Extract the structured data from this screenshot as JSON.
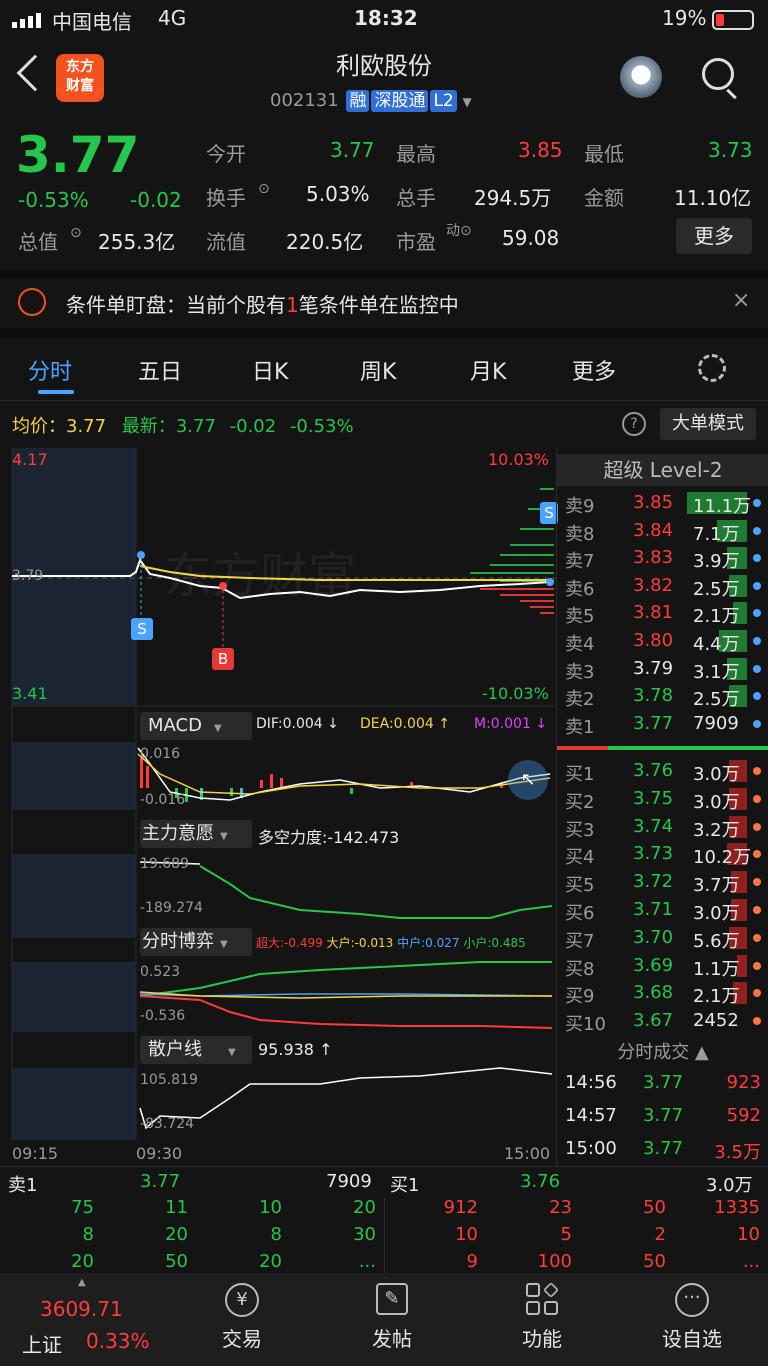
{
  "status": {
    "carrier": "中国电信",
    "net": "4G",
    "time": "18:32",
    "battery": "19%"
  },
  "header": {
    "logo": "东方\n财富",
    "title": "利欧股份",
    "code": "002131",
    "tags": [
      "融",
      "深股通",
      "L2"
    ]
  },
  "quote": {
    "price": "3.77",
    "pct": "-0.53%",
    "chg": "-0.02",
    "f": [
      [
        "今开",
        "3.77"
      ],
      [
        "最高",
        "3.85"
      ],
      [
        "最低",
        "3.73"
      ],
      [
        "换手",
        "5.03%"
      ],
      [
        "总手",
        "294.5万"
      ],
      [
        "金额",
        "11.10亿"
      ],
      [
        "总值",
        "255.3亿"
      ],
      [
        "流值",
        "220.5亿"
      ],
      [
        "市盈",
        "59.08"
      ]
    ],
    "more": "更多"
  },
  "notice": {
    "a": "条件单盯盘：当前个股有",
    "num": "1",
    "b": "笔条件单在监控中"
  },
  "tabs": [
    "分时",
    "五日",
    "日K",
    "周K",
    "月K",
    "更多"
  ],
  "avg": {
    "label": "均价：",
    "avg": "3.77",
    "latest_label": "最新：",
    "latest": "3.77",
    "chg": "-0.02",
    "pct": "-0.53%",
    "mode": "大单模式"
  },
  "chart": {
    "ytop": "4.17",
    "ybot": "3.41",
    "mid": "3.79",
    "ptop": "10.03%",
    "pbot": "-10.03%",
    "watermark": "东方财富",
    "s": "S",
    "b": "B",
    "macd": {
      "name": "MACD",
      "dif": "DIF:0.004 ↓",
      "dea": "DEA:0.004 ↑",
      "m": "M:0.001 ↓",
      "top": "0.016",
      "bot": "-0.016"
    },
    "zl": {
      "name": "主力意愿",
      "val": "多空力度:-142.473",
      "top": "19.689",
      "bot": "-189.274"
    },
    "bo": {
      "name": "分时博弈",
      "a": "超大:-0.499",
      "b": "大户:-0.013",
      "c": "中户:0.027",
      "d": "小户:0.485",
      "top": "0.523",
      "bot": "-0.536"
    },
    "sh": {
      "name": "散户线",
      "val": "95.938 ↑",
      "top": "105.819",
      "bot": "-83.724"
    },
    "times": [
      "09:15",
      "09:30",
      "15:00"
    ]
  },
  "level2": {
    "title": "超级 Level-2",
    "sells": [
      [
        "卖9",
        "3.85",
        "11.1万"
      ],
      [
        "卖8",
        "3.84",
        "7.1万"
      ],
      [
        "卖7",
        "3.83",
        "3.9万"
      ],
      [
        "卖6",
        "3.82",
        "2.5万"
      ],
      [
        "卖5",
        "3.81",
        "2.1万"
      ],
      [
        "卖4",
        "3.80",
        "4.4万"
      ],
      [
        "卖3",
        "3.79",
        "3.1万"
      ],
      [
        "卖2",
        "3.78",
        "2.5万"
      ],
      [
        "卖1",
        "3.77",
        "7909"
      ]
    ],
    "buys": [
      [
        "买1",
        "3.76",
        "3.0万"
      ],
      [
        "买2",
        "3.75",
        "3.0万"
      ],
      [
        "买3",
        "3.74",
        "3.2万"
      ],
      [
        "买4",
        "3.73",
        "10.2万"
      ],
      [
        "买5",
        "3.72",
        "3.7万"
      ],
      [
        "买6",
        "3.71",
        "3.0万"
      ],
      [
        "买7",
        "3.70",
        "5.6万"
      ],
      [
        "买8",
        "3.69",
        "1.1万"
      ],
      [
        "买9",
        "3.68",
        "2.1万"
      ],
      [
        "买10",
        "3.67",
        "2452"
      ]
    ],
    "trades_title": "分时成交",
    "trades": [
      [
        "14:56",
        "3.77",
        "923"
      ],
      [
        "14:57",
        "3.77",
        "592"
      ],
      [
        "15:00",
        "3.77",
        "3.5万"
      ]
    ]
  },
  "queue": {
    "s_label": "卖1",
    "s_price": "3.77",
    "s_vol": "7909",
    "b_label": "买1",
    "b_price": "3.76",
    "b_vol": "3.0万",
    "s_rows": [
      [
        "75",
        "11",
        "10",
        "20"
      ],
      [
        "8",
        "20",
        "8",
        "30"
      ],
      [
        "20",
        "50",
        "20",
        "..."
      ]
    ],
    "b_rows": [
      [
        "912",
        "23",
        "50",
        "1335"
      ],
      [
        "10",
        "5",
        "2",
        "10"
      ],
      [
        "9",
        "100",
        "50",
        "..."
      ]
    ]
  },
  "bottom": {
    "index": "3609.71",
    "index_name": "上证",
    "index_pct": "0.33%",
    "items": [
      "交易",
      "发帖",
      "功能",
      "设自选"
    ]
  }
}
